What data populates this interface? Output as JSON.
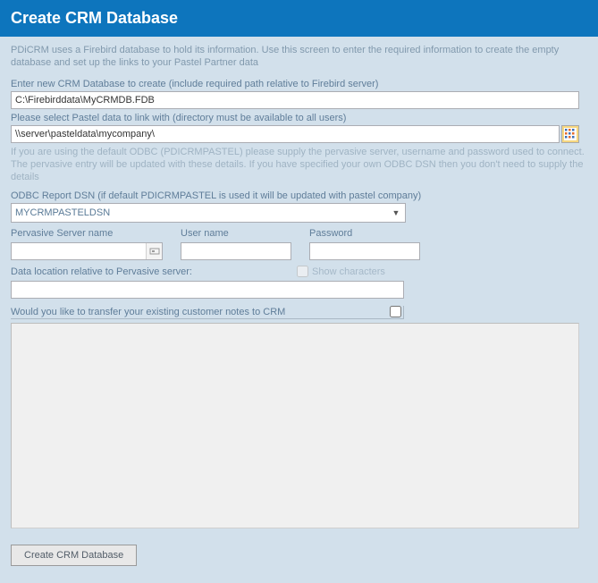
{
  "header": {
    "title": "Create CRM Database"
  },
  "intro": "PDiCRM uses a Firebird database to hold its information. Use this screen to enter the required information to create the empty database and set up the links to your Pastel Partner data",
  "crm_db": {
    "label": "Enter new CRM Database to create (include required path relative to Firebird server)",
    "value": "C:\\Firebirddata\\MyCRMDB.FDB"
  },
  "pastel_path": {
    "label": "Please select Pastel data to link with (directory must be available to all users)",
    "value": "\\\\server\\pasteldata\\mycompany\\",
    "help": "If you are using the default ODBC (PDICRMPASTEL) please supply the pervasive server, username and password used to connect. The pervasive entry will be updated with these details. If you have specified your own ODBC DSN then you don't need to supply the details"
  },
  "dsn": {
    "label": "ODBC Report DSN (if default PDICRMPASTEL is used it will be updated with pastel company)",
    "value": "MYCRMPASTELDSN"
  },
  "pervasive": {
    "server_label": "Pervasive Server name",
    "server_value": "",
    "user_label": "User name",
    "user_value": "",
    "password_label": "Password",
    "password_value": ""
  },
  "show_chars_label": "Show characters",
  "data_location": {
    "label": "Data location relative to Pervasive server:",
    "value": ""
  },
  "transfer_label": "Would you like to transfer your existing customer notes to CRM",
  "create_button_label": "Create CRM Database"
}
